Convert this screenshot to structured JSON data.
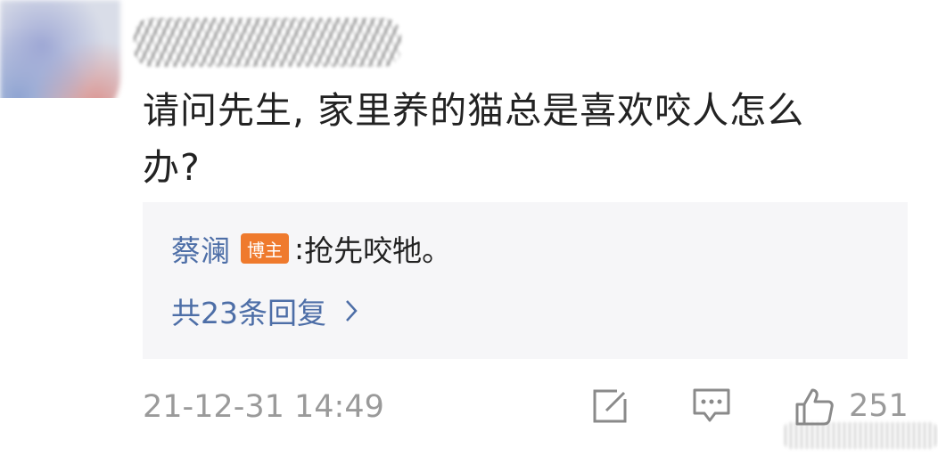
{
  "comment": {
    "text": "请问先生, 家里养的猫总是喜欢咬人怎么办?"
  },
  "reply": {
    "author": "蔡澜",
    "badge": "博主",
    "separator": ":",
    "text": "抢先咬牠。",
    "count_label": "共23条回复"
  },
  "footer": {
    "timestamp": "21-12-31 14:49",
    "like_count": "251"
  },
  "colors": {
    "link": "#4d6ea7",
    "badge": "#ef7a2d",
    "reply_bg": "#f6f6f8",
    "muted": "#9a9a9a"
  },
  "icons": [
    "edit-icon",
    "comment-icon",
    "thumbs-up-icon",
    "chevron-right-icon"
  ]
}
